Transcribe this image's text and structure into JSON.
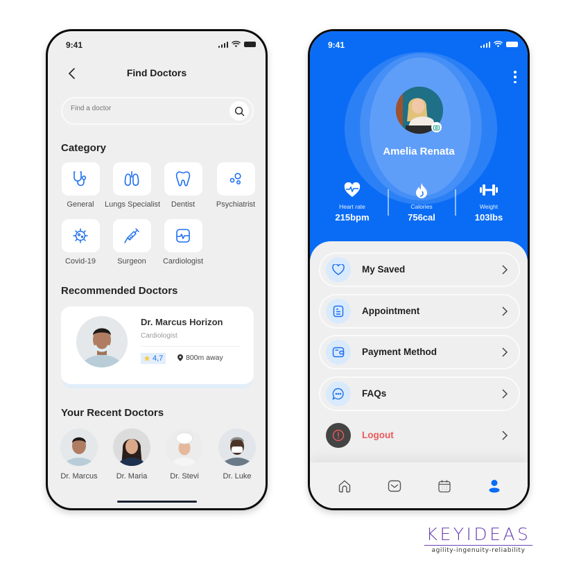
{
  "find_doctors": {
    "status_time": "9:41",
    "title": "Find Doctors",
    "search": {
      "placeholder": "Find a doctor",
      "value": ""
    },
    "category_title": "Category",
    "categories": [
      {
        "label": "General",
        "icon": "stethoscope-icon"
      },
      {
        "label": "Lungs Specialist",
        "icon": "lungs-icon"
      },
      {
        "label": "Dentist",
        "icon": "tooth-icon"
      },
      {
        "label": "Psychiatrist",
        "icon": "bubbles-icon"
      },
      {
        "label": "Covid-19",
        "icon": "virus-icon"
      },
      {
        "label": "Surgeon",
        "icon": "syringe-icon"
      },
      {
        "label": "Cardiologist",
        "icon": "heart-monitor-icon"
      }
    ],
    "recommended_title": "Recommended Doctors",
    "recommended": {
      "name": "Dr. Marcus Horizon",
      "specialty": "Cardiologist",
      "rating": "4,7",
      "distance": "800m away"
    },
    "recent_title": "Your Recent Doctors",
    "recent": [
      {
        "name": "Dr. Marcus"
      },
      {
        "name": "Dr. Maria"
      },
      {
        "name": "Dr. Stevi"
      },
      {
        "name": "Dr. Luke"
      }
    ]
  },
  "profile": {
    "status_time": "9:41",
    "name": "Amelia Renata",
    "stats": [
      {
        "label": "Heart rate",
        "value": "215bpm",
        "icon": "heart-pulse-icon"
      },
      {
        "label": "Calories",
        "value": "756cal",
        "icon": "flame-icon"
      },
      {
        "label": "Weight",
        "value": "103lbs",
        "icon": "dumbbell-icon"
      }
    ],
    "menu": [
      {
        "label": "My Saved",
        "icon": "heart-icon"
      },
      {
        "label": "Appointment",
        "icon": "document-icon"
      },
      {
        "label": "Payment Method",
        "icon": "wallet-icon"
      },
      {
        "label": "FAQs",
        "icon": "chat-icon"
      },
      {
        "label": "Logout",
        "icon": "alert-icon"
      }
    ],
    "tabs": [
      {
        "name": "home",
        "active": false
      },
      {
        "name": "messages",
        "active": false
      },
      {
        "name": "calendar",
        "active": false
      },
      {
        "name": "profile",
        "active": true
      }
    ]
  },
  "brand": {
    "name": "KEYIDEAS",
    "tagline": "agility-ingenuity-reliability"
  },
  "colors": {
    "primary": "#0a6cf5",
    "icon_blue": "#1e6ff0",
    "logout_red": "#e85a5a",
    "brand_purple": "#6a3fb3"
  }
}
